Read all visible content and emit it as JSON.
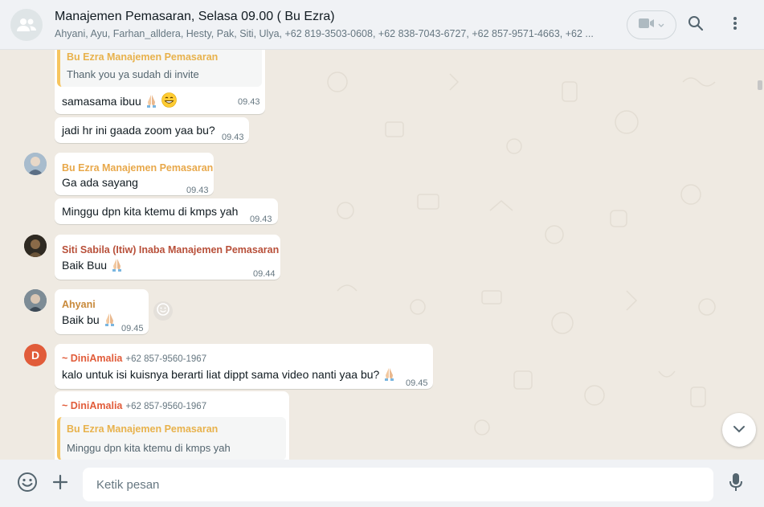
{
  "header": {
    "title": "Manajemen Pemasaran, Selasa 09.00 ( Bu Ezra)",
    "members": "Ahyani, Ayu, Farhan_alldera, Hesty, Pak, Siti, Ulya, +62 819-3503-0608, +62 838-7043-6727, +62 857-9571-4663, +62 ...",
    "icons": [
      "group-icon",
      "video-icon",
      "chevron-down-icon",
      "search-icon",
      "menu-icon"
    ]
  },
  "messages": [
    {
      "quote_sender": "Bu Ezra Manajemen Pemasaran",
      "quote_text": "Thank you ya sudah di invite",
      "text": "samasama ibuu",
      "time": "09.43"
    },
    {
      "text": "jadi hr ini gaada zoom yaa bu?",
      "time": "09.43"
    },
    {
      "sender": "Bu Ezra Manajemen Pemasaran",
      "text": "Ga ada sayang",
      "time": "09.43"
    },
    {
      "text": "Minggu dpn kita ktemu di kmps yah",
      "time": "09.43"
    },
    {
      "sender": "Siti Sabila (Itiw) Inaba Manajemen Pemasaran",
      "text": "Baik Buu",
      "time": "09.44"
    },
    {
      "sender": "Ahyani",
      "text": "Baik bu",
      "time": "09.45"
    },
    {
      "sender": "~ DiniAmalia",
      "phone": "+62 857-9560-1967",
      "avatar_letter": "D",
      "text": "kalo untuk isi kuisnya berarti liat dippt sama video nanti yaa bu?",
      "time": "09.45"
    },
    {
      "sender": "~ DiniAmalia",
      "phone": "+62 857-9560-1967",
      "quote_sender": "Bu Ezra Manajemen Pemasaran",
      "quote_text": "Minggu dpn kita ktemu di kmps yah"
    }
  ],
  "colors": {
    "bu_ezra": "#e8a84a",
    "siti": "#b8503a",
    "ahyani": "#c8893a",
    "dini": "#e15c3a",
    "background": "#efeae2"
  },
  "footer": {
    "placeholder": "Ketik pesan",
    "icons": [
      "emoji-icon",
      "plus-icon",
      "microphone-icon"
    ]
  }
}
